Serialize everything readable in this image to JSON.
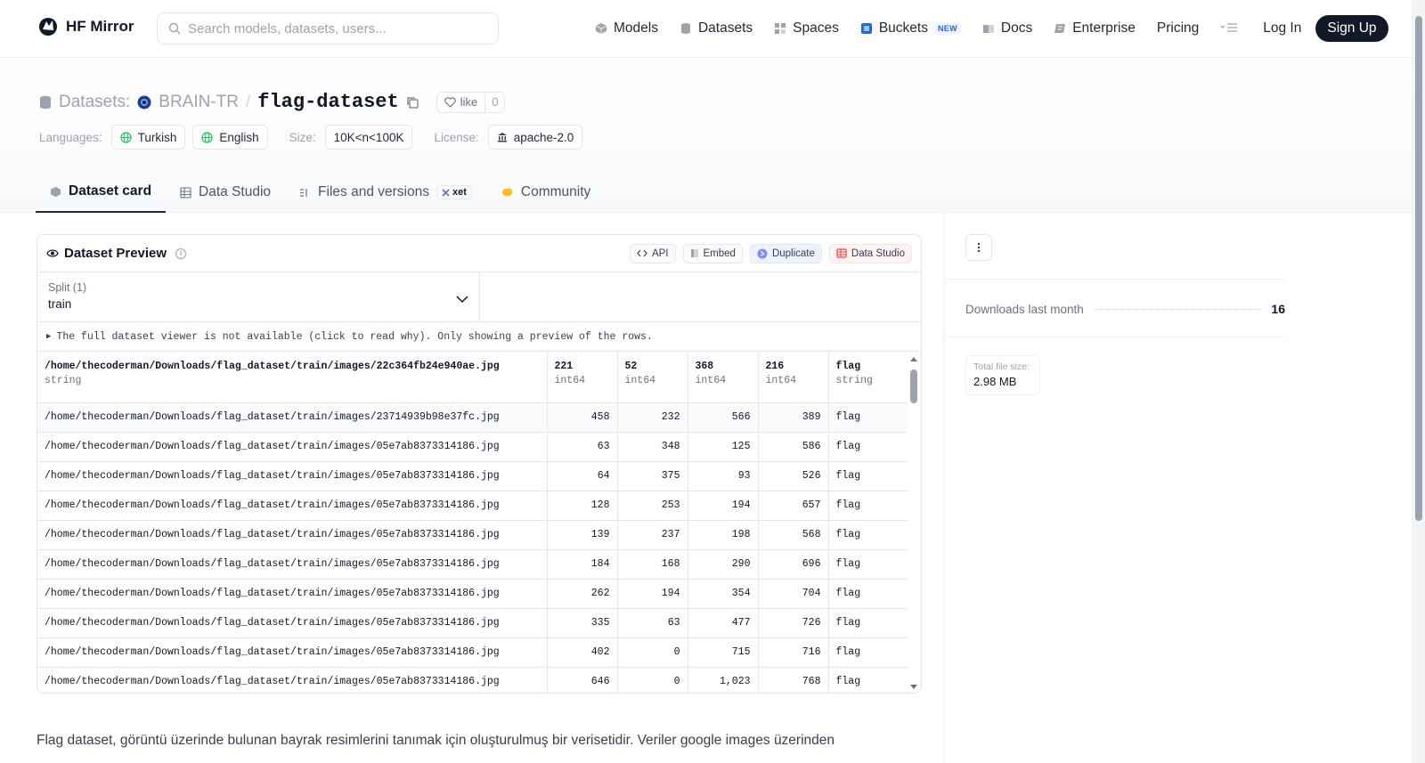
{
  "nav": {
    "brand": "HF Mirror",
    "search_placeholder": "Search models, datasets, users...",
    "links": [
      {
        "label": "Models",
        "icon": "cube-icon"
      },
      {
        "label": "Datasets",
        "icon": "database-icon"
      },
      {
        "label": "Spaces",
        "icon": "grid-icon"
      },
      {
        "label": "Buckets",
        "icon": "bucket-icon",
        "badge": "NEW"
      },
      {
        "label": "Docs",
        "icon": "book-icon"
      },
      {
        "label": "Enterprise",
        "icon": "enterprise-icon"
      },
      {
        "label": "Pricing"
      }
    ],
    "login": "Log In",
    "signup": "Sign Up"
  },
  "header": {
    "section_label": "Datasets:",
    "org": "BRAIN-TR",
    "separator": "/",
    "name": "flag-dataset",
    "like_label": "like",
    "like_count": "0",
    "languages_label": "Languages:",
    "languages": [
      "Turkish",
      "English"
    ],
    "size_label": "Size:",
    "size": "10K<n<100K",
    "license_label": "License:",
    "license": "apache-2.0"
  },
  "tabs": [
    {
      "label": "Dataset card",
      "active": true
    },
    {
      "label": "Data Studio"
    },
    {
      "label": "Files and versions",
      "badge": "xet"
    },
    {
      "label": "Community"
    }
  ],
  "preview": {
    "title": "Dataset Preview",
    "buttons": {
      "api": "API",
      "embed": "Embed",
      "duplicate": "Duplicate",
      "studio": "Data Studio"
    },
    "split_label": "Split (1)",
    "split_value": "train",
    "notice": "The full dataset viewer is not available (click to read why). Only showing a preview of the rows.",
    "columns": [
      {
        "name": "/home/thecoderman/Downloads/flag_dataset/train/images/22c364fb24e940ae.jpg",
        "type": "string"
      },
      {
        "name": "221",
        "type": "int64"
      },
      {
        "name": "52",
        "type": "int64"
      },
      {
        "name": "368",
        "type": "int64"
      },
      {
        "name": "216",
        "type": "int64"
      },
      {
        "name": "flag",
        "type": "string"
      }
    ],
    "rows": [
      [
        "/home/thecoderman/Downloads/flag_dataset/train/images/23714939b98e37fc.jpg",
        "458",
        "232",
        "566",
        "389",
        "flag"
      ],
      [
        "/home/thecoderman/Downloads/flag_dataset/train/images/05e7ab8373314186.jpg",
        "63",
        "348",
        "125",
        "586",
        "flag"
      ],
      [
        "/home/thecoderman/Downloads/flag_dataset/train/images/05e7ab8373314186.jpg",
        "64",
        "375",
        "93",
        "526",
        "flag"
      ],
      [
        "/home/thecoderman/Downloads/flag_dataset/train/images/05e7ab8373314186.jpg",
        "128",
        "253",
        "194",
        "657",
        "flag"
      ],
      [
        "/home/thecoderman/Downloads/flag_dataset/train/images/05e7ab8373314186.jpg",
        "139",
        "237",
        "198",
        "568",
        "flag"
      ],
      [
        "/home/thecoderman/Downloads/flag_dataset/train/images/05e7ab8373314186.jpg",
        "184",
        "168",
        "290",
        "696",
        "flag"
      ],
      [
        "/home/thecoderman/Downloads/flag_dataset/train/images/05e7ab8373314186.jpg",
        "262",
        "194",
        "354",
        "704",
        "flag"
      ],
      [
        "/home/thecoderman/Downloads/flag_dataset/train/images/05e7ab8373314186.jpg",
        "335",
        "63",
        "477",
        "726",
        "flag"
      ],
      [
        "/home/thecoderman/Downloads/flag_dataset/train/images/05e7ab8373314186.jpg",
        "402",
        "0",
        "715",
        "716",
        "flag"
      ],
      [
        "/home/thecoderman/Downloads/flag_dataset/train/images/05e7ab8373314186.jpg",
        "646",
        "0",
        "1,023",
        "768",
        "flag"
      ]
    ]
  },
  "description": "Flag dataset, görüntü üzerinde bulunan bayrak resimlerini tanımak için oluşturulmuş bir verisetidir. Veriler google images üzerinden",
  "sidebar": {
    "downloads_label": "Downloads last month",
    "downloads_value": "16",
    "filesize_label": "Total file size:",
    "filesize_value": "2.98 MB"
  },
  "colors": {
    "accent_dark": "#111827",
    "studio_red": "#ef4444",
    "duplicate_indigo": "#6366f1",
    "buckets_blue": "#2563eb"
  }
}
